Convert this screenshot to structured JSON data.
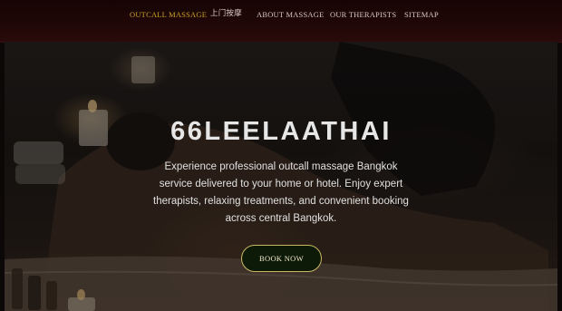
{
  "nav": {
    "items": [
      {
        "label": "OUTCALL MASSAGE",
        "active": true
      },
      {
        "label": "上门按摩",
        "active": false
      },
      {
        "label": "ABOUT MASSAGE",
        "active": false
      },
      {
        "label": "OUR THERAPISTS",
        "active": false
      },
      {
        "label": "SITEMAP",
        "active": false
      }
    ]
  },
  "hero": {
    "title": "66LEELAATHAI",
    "description": "Experience professional outcall massage Bangkok service delivered to your home or hotel. Enjoy expert therapists, relaxing treatments, and convenient booking across central Bangkok.",
    "cta_label": "BOOK NOW"
  },
  "colors": {
    "nav_active": "#c9a227",
    "nav_text": "#d9c9c2",
    "cta_border": "#c9b860",
    "nav_bg": "#200707"
  }
}
